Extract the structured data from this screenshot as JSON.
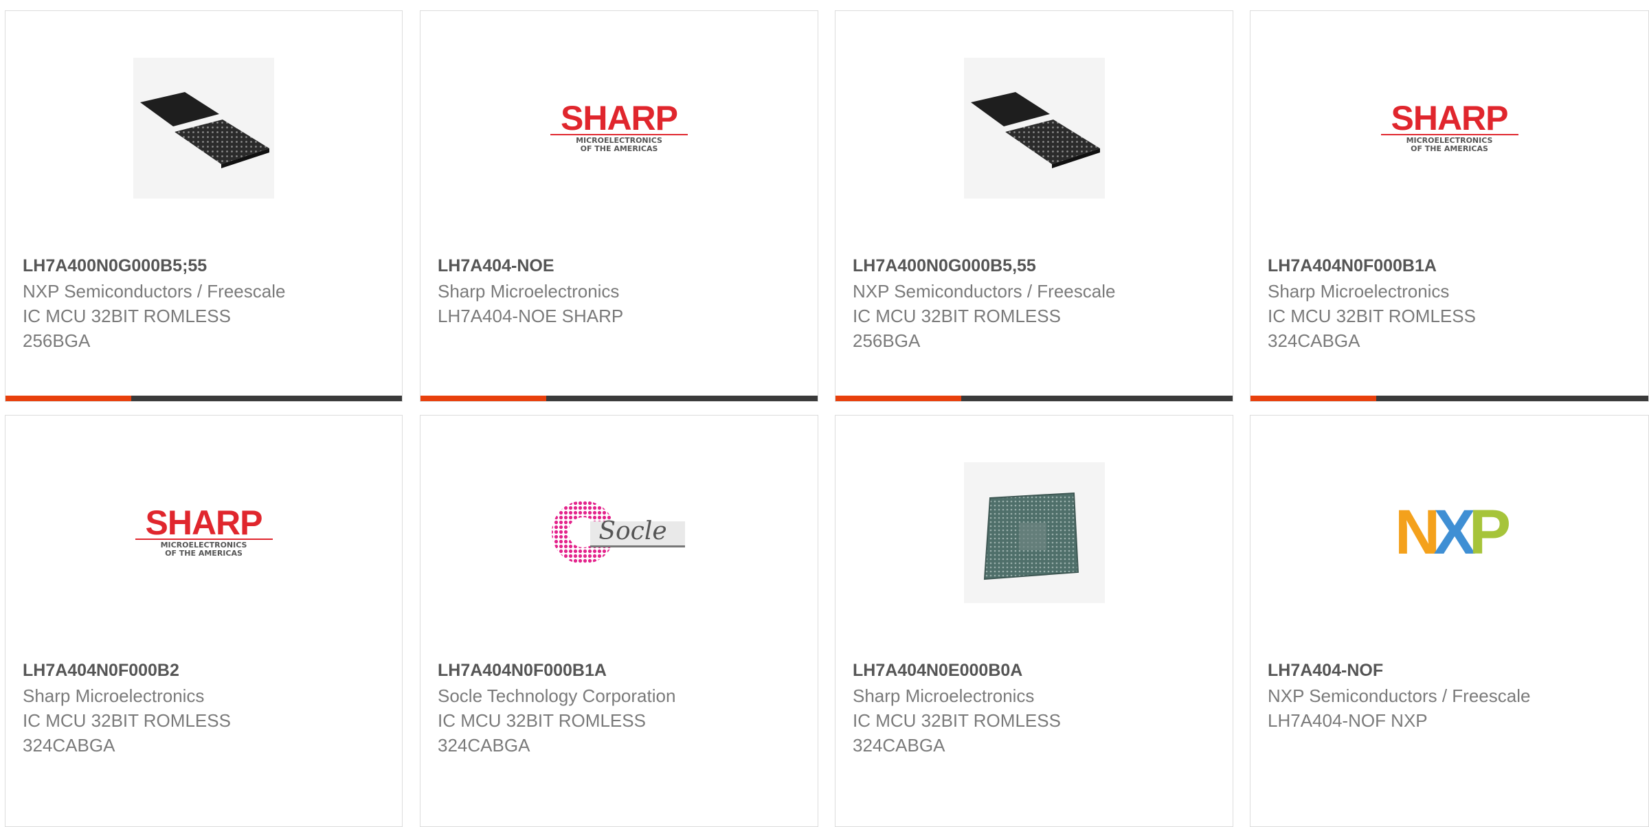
{
  "brand_colors": {
    "accent_bar": "#e8400c",
    "dark_bar": "#3a3a3a",
    "sharp_red": "#e0262d",
    "socle_pink": "#e3238b",
    "nxp_orange": "#f4a11c",
    "nxp_blue": "#3f8fd4",
    "nxp_green": "#a6c43a"
  },
  "products": [
    {
      "part_number": "LH7A400N0G000B5;55",
      "manufacturer": "NXP Semiconductors / Freescale",
      "desc1": "IC MCU 32BIT ROMLESS",
      "desc2": "256BGA",
      "image": "bga-chip-pair-icon"
    },
    {
      "part_number": "LH7A404-NOE",
      "manufacturer": "Sharp Microelectronics",
      "desc1": "LH7A404-NOE SHARP",
      "desc2": "",
      "image": "sharp-logo",
      "logo": {
        "word": "SHARP",
        "sub1": "MICROELECTRONICS",
        "sub2": "OF THE AMERICAS"
      }
    },
    {
      "part_number": "LH7A400N0G000B5,55",
      "manufacturer": "NXP Semiconductors / Freescale",
      "desc1": "IC MCU 32BIT ROMLESS",
      "desc2": "256BGA",
      "image": "bga-chip-pair-icon"
    },
    {
      "part_number": "LH7A404N0F000B1A",
      "manufacturer": "Sharp Microelectronics",
      "desc1": "IC MCU 32BIT ROMLESS",
      "desc2": "324CABGA",
      "image": "sharp-logo",
      "logo": {
        "word": "SHARP",
        "sub1": "MICROELECTRONICS",
        "sub2": "OF THE AMERICAS"
      }
    },
    {
      "part_number": "LH7A404N0F000B2",
      "manufacturer": "Sharp Microelectronics",
      "desc1": "IC MCU 32BIT ROMLESS",
      "desc2": "324CABGA",
      "image": "sharp-logo",
      "logo": {
        "word": "SHARP",
        "sub1": "MICROELECTRONICS",
        "sub2": "OF THE AMERICAS"
      }
    },
    {
      "part_number": "LH7A404N0F000B1A",
      "manufacturer": "Socle Technology Corporation",
      "desc1": "IC MCU 32BIT ROMLESS",
      "desc2": "324CABGA",
      "image": "socle-logo",
      "logo": {
        "word": "Socle"
      }
    },
    {
      "part_number": "LH7A404N0E000B0A",
      "manufacturer": "Sharp Microelectronics",
      "desc1": "IC MCU 32BIT ROMLESS",
      "desc2": "324CABGA",
      "image": "bga-chip-single-icon"
    },
    {
      "part_number": "LH7A404-NOF",
      "manufacturer": "NXP Semiconductors / Freescale",
      "desc1": "LH7A404-NOF NXP",
      "desc2": "",
      "image": "nxp-logo",
      "logo": {
        "word": "NXP"
      }
    }
  ]
}
